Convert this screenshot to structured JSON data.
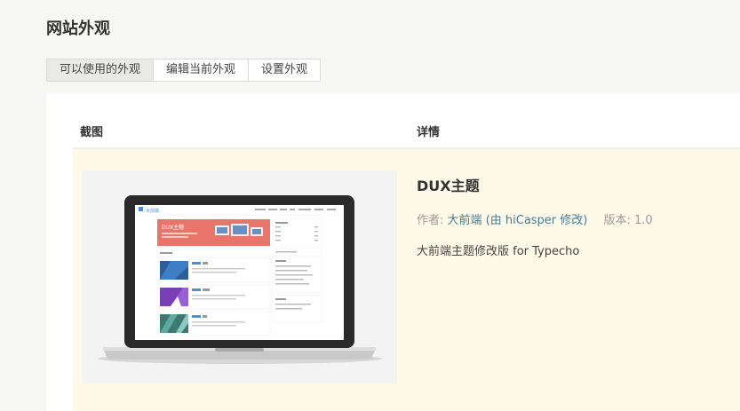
{
  "page": {
    "title": "网站外观"
  },
  "tabs": [
    {
      "label": "可以使用的外观",
      "active": true
    },
    {
      "label": "编辑当前外观",
      "active": false
    },
    {
      "label": "设置外观",
      "active": false
    }
  ],
  "table": {
    "headers": {
      "screenshot": "截图",
      "details": "详情"
    },
    "rows": [
      {
        "name": "DUX主题",
        "author_label": "作者:",
        "author_name": "大前端",
        "author_mod": "(由 hiCasper 修改)",
        "version_label": "版本:",
        "version": "1.0",
        "description": "大前端主题修改版 for Typecho",
        "preview": {
          "site_name": "大前端",
          "banner_title": "DUX主题",
          "nav_items": [
            "首页",
            "分类",
            "标签",
            "关于",
            "搜索"
          ],
          "colors": {
            "banner": "#e9746a",
            "thumb1": "#2c5f9a",
            "thumb2": "#7b3fb5",
            "thumb3": "#3b7a73",
            "accent": "#4a90d9"
          }
        }
      }
    ]
  }
}
